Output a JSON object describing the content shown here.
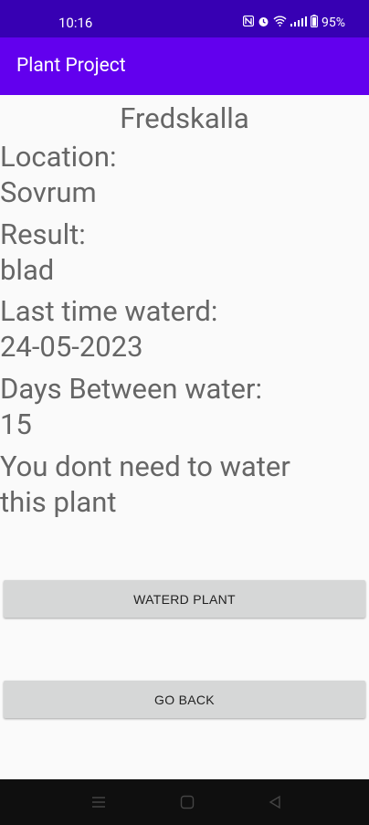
{
  "status_bar": {
    "time": "10:16",
    "battery": "95%"
  },
  "app_bar": {
    "title": "Plant Project"
  },
  "plant": {
    "name": "Fredskalla",
    "location_label": "Location:",
    "location_value": "Sovrum",
    "result_label": "Result:",
    "result_value": "blad",
    "last_watered_label": "Last time waterd:",
    "last_watered_value": "24-05-2023",
    "days_between_label": "Days Between water:",
    "days_between_value": "15",
    "message_line1": "You dont need to water",
    "message_line2": "this plant"
  },
  "buttons": {
    "watered": "WATERD PLANT",
    "go_back": "GO BACK"
  },
  "icons": {
    "status": [
      "nfc-icon",
      "alarm-icon",
      "wifi-icon",
      "signal-icon",
      "battery-icon"
    ],
    "nav": [
      "menu-icon",
      "home-icon",
      "back-icon"
    ]
  },
  "colors": {
    "status_bar": "#3700b3",
    "app_bar": "#6200ee",
    "button": "#d6d7d7"
  }
}
